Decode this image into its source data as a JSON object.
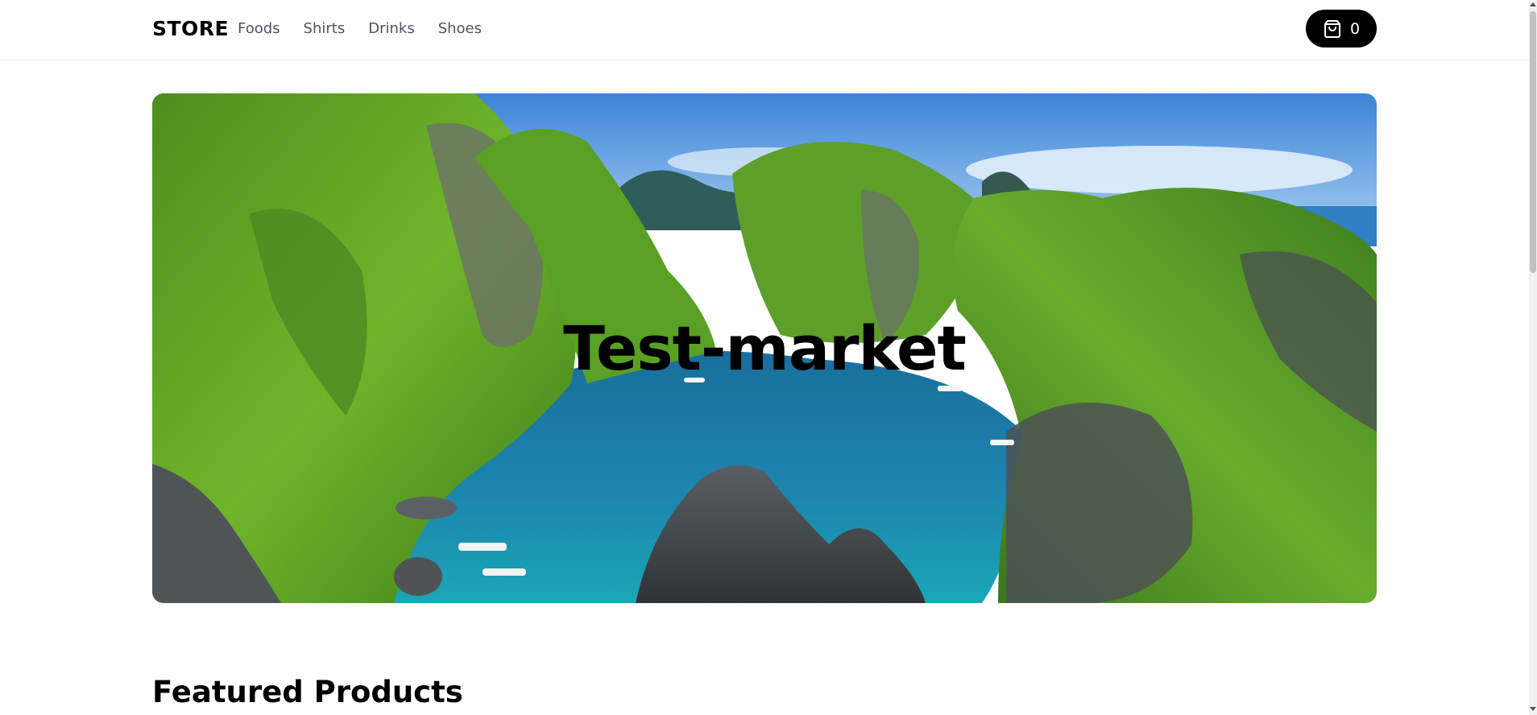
{
  "header": {
    "brand": "STORE",
    "nav": [
      "Foods",
      "Shirts",
      "Drinks",
      "Shoes"
    ],
    "cart": {
      "icon": "shopping-bag-icon",
      "count": "0"
    }
  },
  "hero": {
    "title": "Test-market",
    "image": "tropical-lagoon-with-limestone-cliffs-and-boats"
  },
  "sections": {
    "featured_title": "Featured Products"
  },
  "colors": {
    "accent": "#000000",
    "nav_text": "#4b5563",
    "border": "#e5e7eb"
  }
}
